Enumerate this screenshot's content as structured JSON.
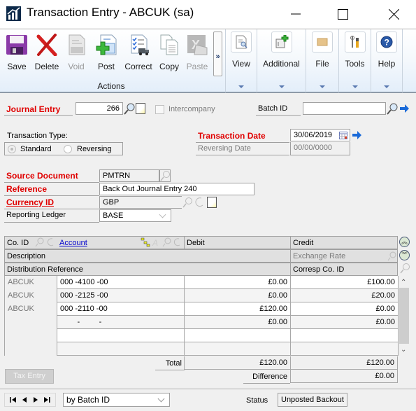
{
  "window": {
    "title": "Transaction Entry  -  ABCUK (sa)",
    "minimize_label": "minimize",
    "maximize_label": "maximize",
    "close_label": "close"
  },
  "ribbon": {
    "actions": [
      {
        "label": "Save",
        "icon": "save-icon",
        "enabled": true
      },
      {
        "label": "Delete",
        "icon": "delete-icon",
        "enabled": true
      },
      {
        "label": "Void",
        "icon": "void-icon",
        "enabled": false
      },
      {
        "label": "Post",
        "icon": "post-icon",
        "enabled": true
      },
      {
        "label": "Correct",
        "icon": "correct-icon",
        "enabled": true
      },
      {
        "label": "Copy",
        "icon": "copy-icon",
        "enabled": true
      },
      {
        "label": "Paste",
        "icon": "paste-icon",
        "enabled": false
      }
    ],
    "actions_group_label": "Actions",
    "expand_label": "»",
    "groups": [
      {
        "label": "View",
        "icon": "view-icon"
      },
      {
        "label": "Additional",
        "icon": "additional-icon"
      },
      {
        "label": "File",
        "icon": "folder-icon"
      },
      {
        "label": "Tools",
        "icon": "tools-icon"
      },
      {
        "label": "Help",
        "icon": "help-icon"
      }
    ]
  },
  "form": {
    "journal_entry": {
      "label": "Journal Entry",
      "value": "266"
    },
    "intercompany": {
      "label": "Intercompany",
      "checked": false
    },
    "batch_id": {
      "label": "Batch ID",
      "value": ""
    },
    "transaction_type": {
      "label": "Transaction Type:",
      "options": [
        "Standard",
        "Reversing"
      ],
      "selected": "Standard"
    },
    "transaction_date": {
      "label": "Transaction Date",
      "value": "30/06/2019"
    },
    "reversing_date": {
      "label": "Reversing Date",
      "value": "00/00/0000"
    },
    "source_document": {
      "label": "Source Document",
      "value": "PMTRN"
    },
    "reference": {
      "label": "Reference",
      "value": "Back Out Journal Entry 240"
    },
    "currency_id": {
      "label": "Currency ID",
      "value": "GBP"
    },
    "reporting_ledger": {
      "label": "Reporting Ledger",
      "value": "BASE"
    }
  },
  "grid": {
    "headers": {
      "co_id": "Co. ID",
      "account": "Account",
      "debit": "Debit",
      "credit": "Credit",
      "description": "Description",
      "exchange_rate": "Exchange Rate",
      "distribution_reference": "Distribution Reference",
      "corresp_co_id": "Corresp Co. ID"
    },
    "rows": [
      {
        "co_id": "ABCUK",
        "account": "000 -4100 -00",
        "debit": "£0.00",
        "credit": "£100.00"
      },
      {
        "co_id": "ABCUK",
        "account": "000 -2125 -00",
        "debit": "£0.00",
        "credit": "£20.00"
      },
      {
        "co_id": "ABCUK",
        "account": "000 -2110 -00",
        "debit": "£120.00",
        "credit": "£0.00"
      },
      {
        "co_id": "",
        "account": "        -         -",
        "debit": "£0.00",
        "credit": "£0.00"
      },
      {
        "co_id": "",
        "account": "",
        "debit": "",
        "credit": ""
      },
      {
        "co_id": "",
        "account": "",
        "debit": "",
        "credit": ""
      }
    ],
    "total_label": "Total",
    "total_debit": "£120.00",
    "total_credit": "£120.00",
    "difference_label": "Difference",
    "difference_value": "£0.00"
  },
  "tax_entry_label": "Tax Entry",
  "footer": {
    "sort_by": "by Batch ID",
    "status_label": "Status",
    "status_value": "Unposted Backout"
  }
}
